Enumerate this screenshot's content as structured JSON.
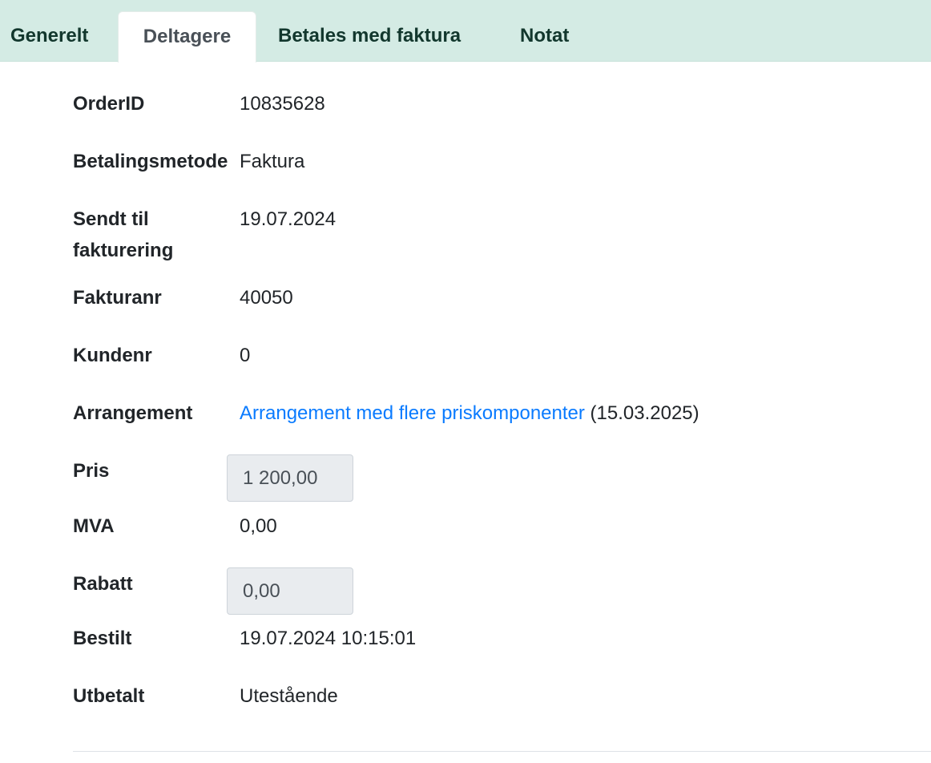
{
  "tabs": [
    {
      "label": "Generelt",
      "active": false
    },
    {
      "label": "Deltagere",
      "active": true
    },
    {
      "label": "Betales med faktura",
      "active": false
    },
    {
      "label": "Notat",
      "active": false
    }
  ],
  "details": {
    "order_id": {
      "label": "OrderID",
      "value": "10835628"
    },
    "payment_method": {
      "label": "Betalingsmetode",
      "value": "Faktura"
    },
    "sent_to_invoicing": {
      "label": "Sendt til fakturering",
      "value": "19.07.2024"
    },
    "invoice_no": {
      "label": "Fakturanr",
      "value": "40050"
    },
    "customer_no": {
      "label": "Kundenr",
      "value": "0"
    },
    "event": {
      "label": "Arrangement",
      "link_text": "Arrangement med flere priskomponenter",
      "date_suffix": "(15.03.2025)"
    },
    "price": {
      "label": "Pris",
      "value": "1 200,00"
    },
    "vat": {
      "label": "MVA",
      "value": "0,00"
    },
    "discount": {
      "label": "Rabatt",
      "value": "0,00"
    },
    "ordered": {
      "label": "Bestilt",
      "value": "19.07.2024 10:15:01"
    },
    "paid_out": {
      "label": "Utbetalt",
      "value": "Utestående"
    }
  },
  "colors": {
    "tabbar_bg": "#d4ebe4",
    "tab_text": "#12372d",
    "link": "#0a7bff",
    "readonly_field_bg": "#e9ecef"
  }
}
